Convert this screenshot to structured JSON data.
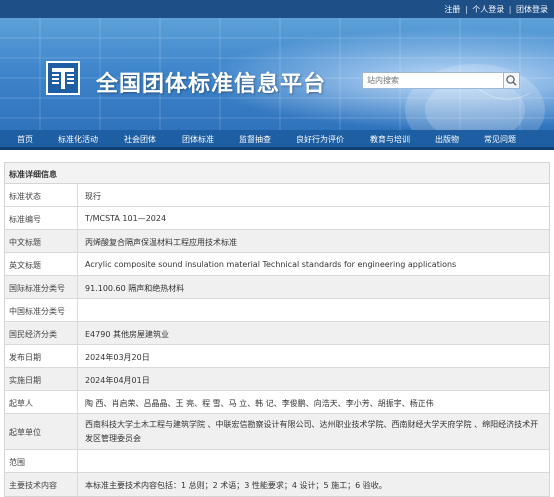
{
  "top_links": [
    "注册",
    "个人登录",
    "团体登录"
  ],
  "site_title": "全国团体标准信息平台",
  "search": {
    "placeholder": "站内搜索"
  },
  "nav": [
    "首页",
    "标准化活动",
    "社会团体",
    "团体标准",
    "监督抽查",
    "良好行为评价",
    "教育与培训",
    "出版物",
    "常见问题"
  ],
  "section_title": "标准详细信息",
  "details": [
    {
      "label": "标准状态",
      "value": "现行"
    },
    {
      "label": "标准编号",
      "value": "T/MCSTA 101—2024"
    },
    {
      "label": "中文标题",
      "value": "丙烯酸复合隔声保温材料工程应用技术标准"
    },
    {
      "label": "英文标题",
      "value": "Acrylic composite sound insulation material Technical standards for engineering applications"
    },
    {
      "label": "国际标准分类号",
      "value": "91.100.60 隔声和绝热材料"
    },
    {
      "label": "中国标准分类号",
      "value": ""
    },
    {
      "label": "国民经济分类",
      "value": "E4790 其他房屋建筑业"
    },
    {
      "label": "发布日期",
      "value": "2024年03月20日"
    },
    {
      "label": "实施日期",
      "value": "2024年04月01日"
    },
    {
      "label": "起草人",
      "value": "陶 西、肖启荣、吕晶晶、王 亮、程 雪、马 立、韩 记、李俊鹏、向浩天、李小芳、胡振宇、杨正伟"
    },
    {
      "label": "起草单位",
      "value": "西南科技大学土木工程与建筑学院 、中联宏信勘察设计有限公司、达州职业技术学院、西南财经大学天府学院 、绵阳经济技术开发区管理委员会"
    },
    {
      "label": "范围",
      "value": ""
    },
    {
      "label": "主要技术内容",
      "value": "本标准主要技术内容包括：1 总则；2 术语；3 性能要求；4 设计；5 施工；6 验收。"
    }
  ]
}
